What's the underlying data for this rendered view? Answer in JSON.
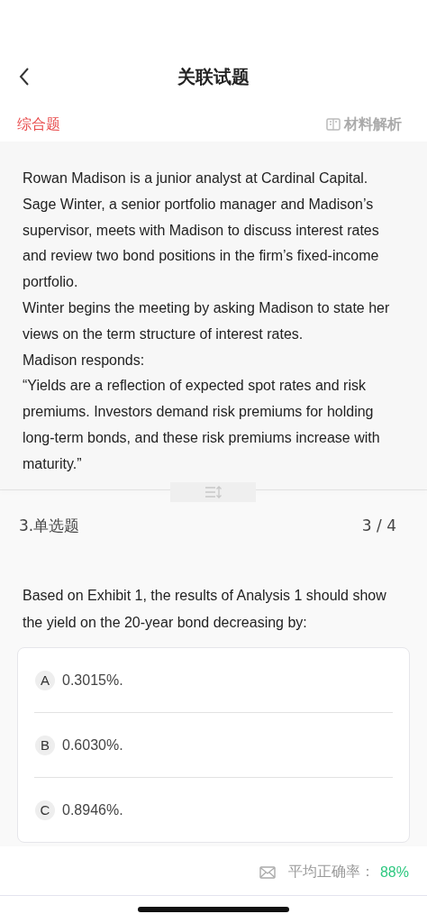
{
  "nav": {
    "title": "关联试题"
  },
  "tabs": {
    "type_label": "综合题",
    "analysis_link": "材料解析"
  },
  "material": [
    "Rowan Madison is a junior analyst at Cardinal Capital. Sage Winter, a senior portfolio manager and Madison’s supervisor, meets with Madison to discuss interest rates and review two bond positions in the firm’s fixed-income portfolio.",
    "Winter begins the meeting by asking Madison to state her views on the term structure of interest rates.",
    "Madison responds:",
    "“Yields are a reflection of expected spot rates and risk premiums. Investors demand risk premiums for holding long-term bonds, and these risk premiums increase with maturity.”"
  ],
  "question": {
    "number_type": "3.单选题",
    "progress": "3 / 4",
    "stem": "Based on Exhibit 1, the results of Analysis 1 should show the yield on the 20-year bond decreasing by:",
    "options": [
      {
        "letter": "A",
        "text": "0.3015%.",
        "selected": false
      },
      {
        "letter": "B",
        "text": "0.6030%.",
        "selected": false
      },
      {
        "letter": "C",
        "text": "0.8946%.",
        "selected": false
      }
    ]
  },
  "footer": {
    "accuracy_label": "平均正确率：",
    "accuracy_value": "88%"
  }
}
